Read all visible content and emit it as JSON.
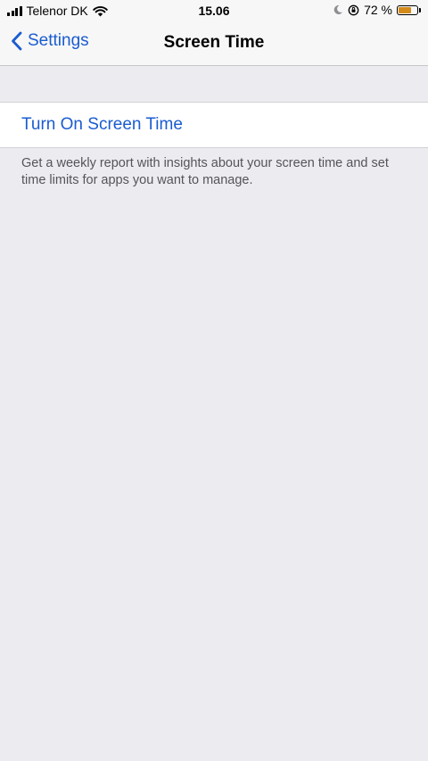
{
  "status_bar": {
    "carrier": "Telenor DK",
    "time": "15.06",
    "battery_percent": "72 %",
    "battery_level": 0.72,
    "icons": [
      "signal-icon",
      "wifi-icon",
      "moon-icon",
      "orientation-lock-icon",
      "battery-icon"
    ],
    "battery_color": "#d48a1a"
  },
  "nav": {
    "back_label": "Settings",
    "title": "Screen Time",
    "accent_color": "#1a5cd0"
  },
  "cell": {
    "label": "Turn On Screen Time"
  },
  "footer": {
    "text": "Get a weekly report with insights about your screen time and set time limits for apps you want to manage."
  }
}
